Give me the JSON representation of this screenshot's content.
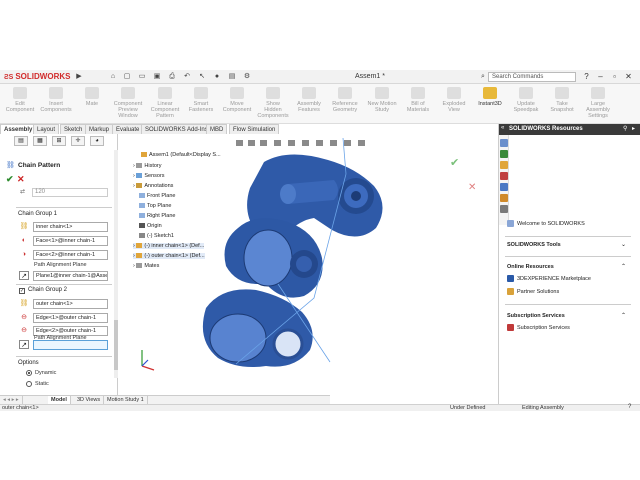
{
  "title_bar": {
    "brand": "SOLIDWORKS",
    "document_title": "Assem1 *",
    "search_placeholder": "Search Commands"
  },
  "ribbon": {
    "buttons": [
      {
        "label": "Edit Component",
        "active": false
      },
      {
        "label": "Insert Components",
        "active": false
      },
      {
        "label": "Mate",
        "active": false
      },
      {
        "label": "Component Preview Window",
        "active": false
      },
      {
        "label": "Linear Component Pattern",
        "active": false
      },
      {
        "label": "Smart Fasteners",
        "active": false
      },
      {
        "label": "Move Component",
        "active": false
      },
      {
        "label": "Show Hidden Components",
        "active": false
      },
      {
        "label": "Assembly Features",
        "active": false
      },
      {
        "label": "Reference Geometry",
        "active": false
      },
      {
        "label": "New Motion Study",
        "active": false
      },
      {
        "label": "Bill of Materials",
        "active": false
      },
      {
        "label": "Exploded View",
        "active": false
      },
      {
        "label": "Instant3D",
        "active": true
      },
      {
        "label": "Update Speedpak",
        "active": false
      },
      {
        "label": "Take Snapshot",
        "active": false
      },
      {
        "label": "Large Assembly Settings",
        "active": false
      }
    ]
  },
  "command_tabs": [
    "Assembly",
    "Layout",
    "Sketch",
    "Markup",
    "Evaluate",
    "SOLIDWORKS Add-Ins",
    "MBD",
    "Flow Simulation"
  ],
  "property_manager": {
    "title": "Chain Pattern",
    "spacing_value": "120",
    "group1": {
      "header": "Chain Group 1",
      "path_field": "inner chain<1>",
      "face1_field": "Face<1>@inner chain-1",
      "face2_field": "Face<2>@inner chain-1",
      "plane_label": "Path Alignment Plane",
      "plane_field": "Plane1@inner chain-1@Asse"
    },
    "group2": {
      "header": "Chain Group 2",
      "path_field": "outer chain<1>",
      "edge1_field": "Edge<1>@outer chain-1",
      "edge2_field": "Edge<2>@outer chain-1",
      "plane_label": "Path Alignment Plane",
      "plane_field": ""
    },
    "options": {
      "header": "Options",
      "dynamic_label": "Dynamic",
      "static_label": "Static",
      "selected": "Dynamic"
    }
  },
  "feature_tree": {
    "root": "Assem1 (Default<Display S...",
    "items": [
      "History",
      "Sensors",
      "Annotations",
      "Front Plane",
      "Top Plane",
      "Right Plane",
      "Origin",
      "(-) Sketch1",
      "(-) inner chain<1> (Def...",
      "(-) outer chain<1> (Def...",
      "Mates"
    ]
  },
  "bottom_tabs": [
    "Model",
    "3D Views",
    "Motion Study 1"
  ],
  "status_bar": {
    "selection": "outer chain<1>",
    "state": "Under Defined",
    "mode": "Editing Assembly"
  },
  "resources_panel": {
    "header": "SOLIDWORKS Resources",
    "welcome": "Welcome to SOLIDWORKS",
    "tools_header": "SOLIDWORKS Tools",
    "online_header": "Online Resources",
    "online_items": [
      "3DEXPERIENCE Marketplace",
      "Partner Solutions"
    ],
    "subscription_header": "Subscription Services",
    "subscription_items": [
      "Subscription Services"
    ]
  },
  "colors": {
    "model_blue": "#2f5aa8",
    "model_light": "#6b93d6",
    "brand_red": "#d12b2b",
    "highlight_yellow": "#e8b93a"
  }
}
